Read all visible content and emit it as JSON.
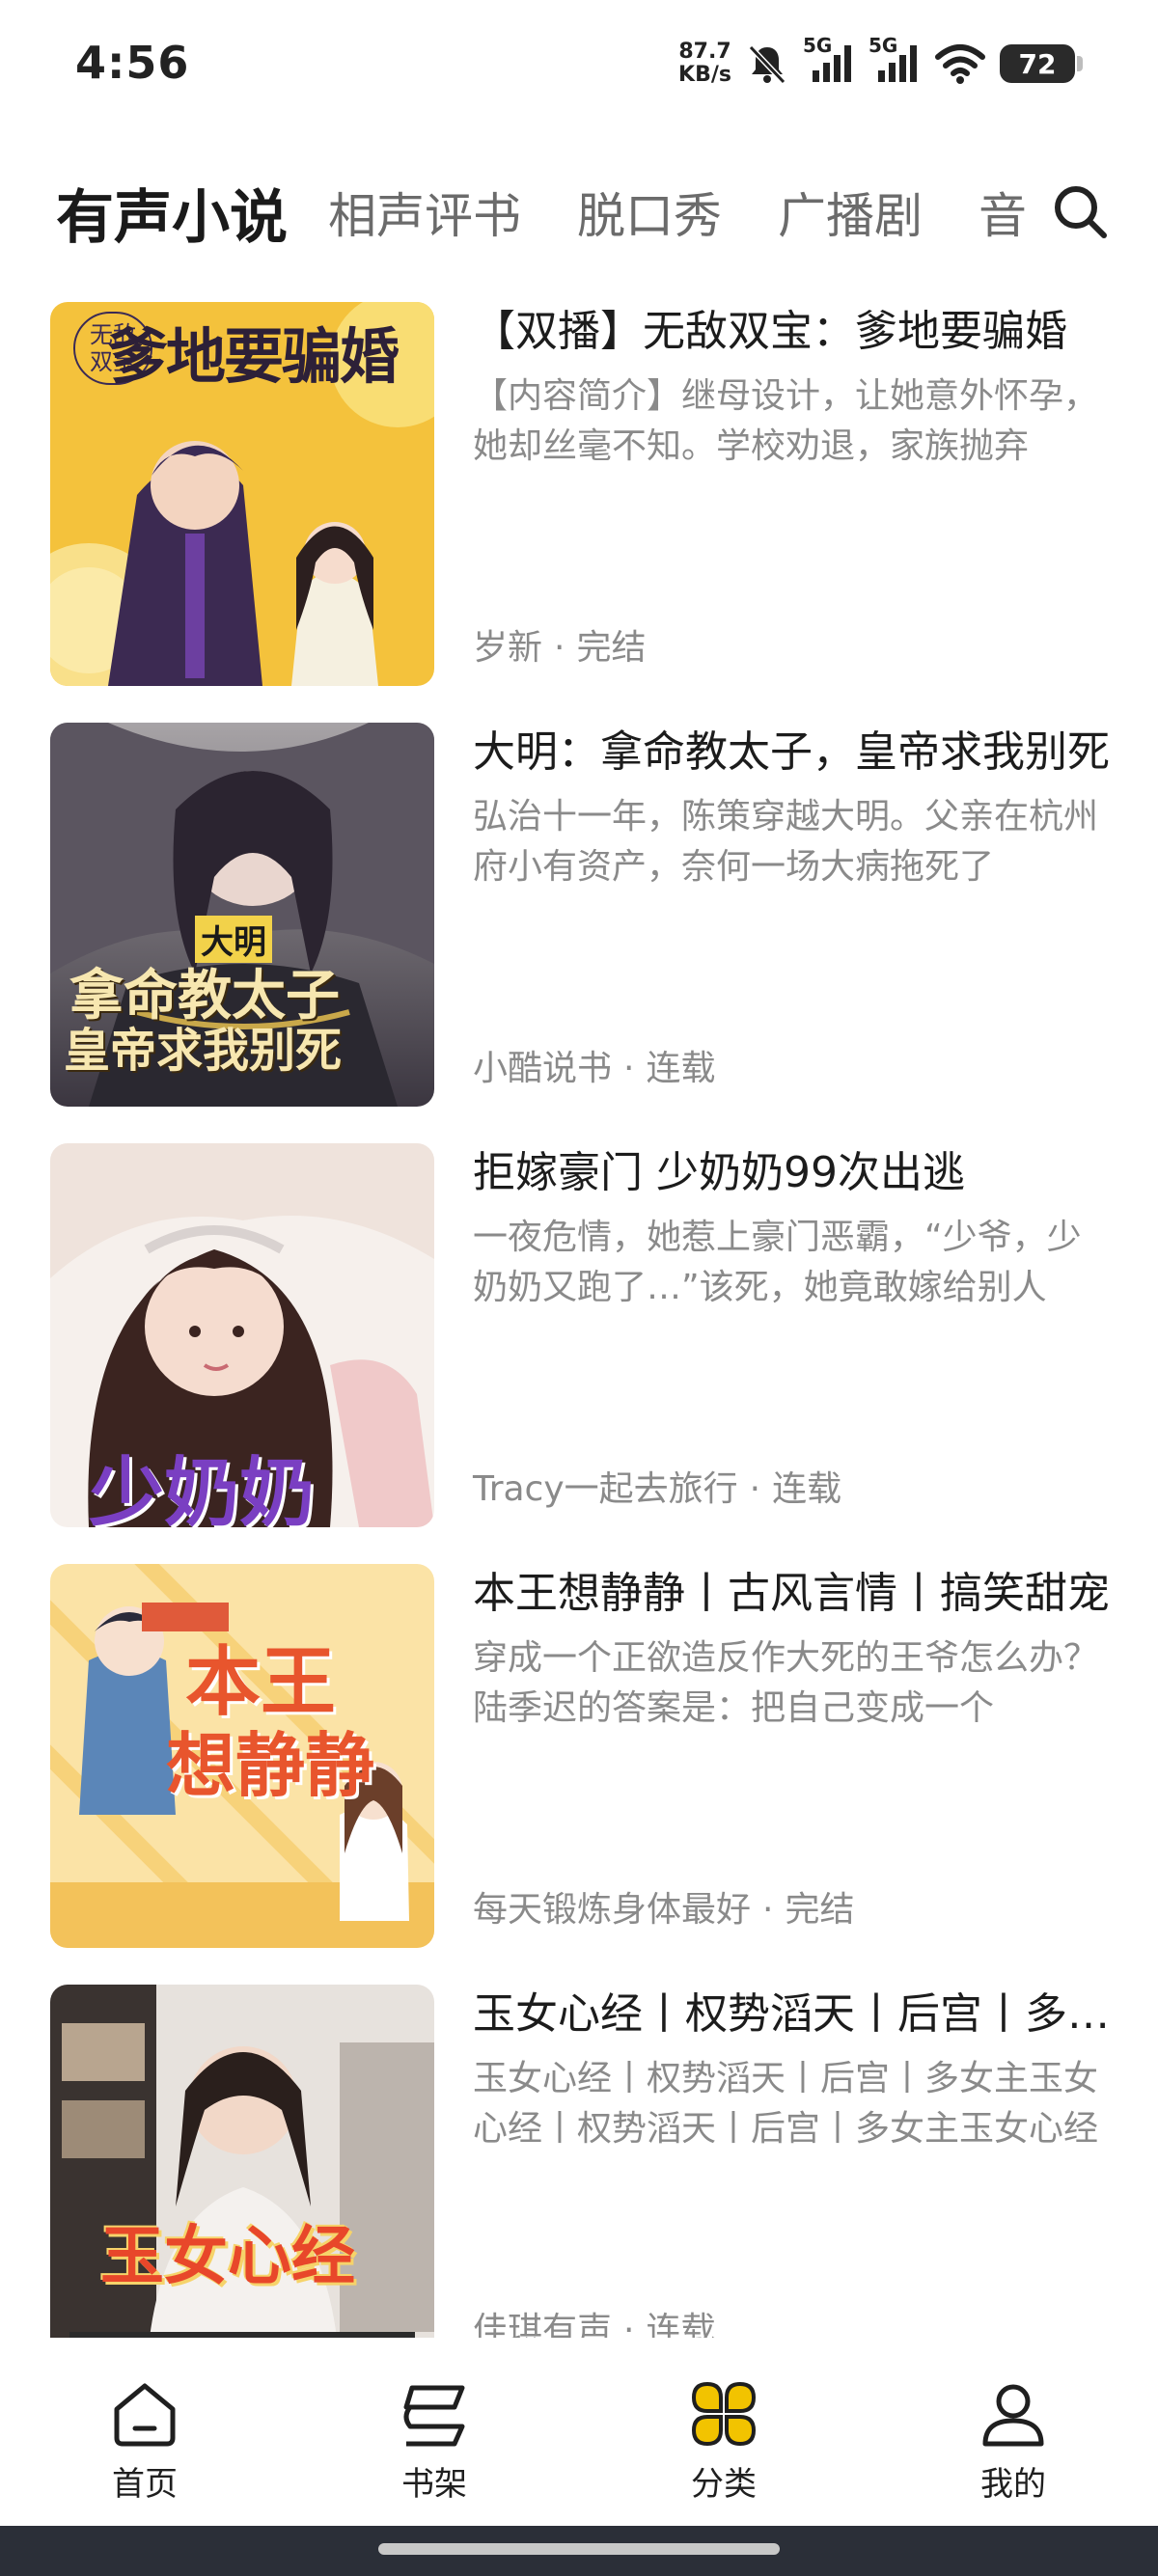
{
  "status_bar": {
    "time": "4:56",
    "net_speed_value": "87.7",
    "net_speed_unit": "KB/s",
    "signal_label_1": "5G",
    "signal_label_2": "5G",
    "battery": "72",
    "icons": [
      "mute-bell-icon",
      "signal-5g-icon",
      "signal-5g-icon",
      "wifi-icon",
      "battery-icon"
    ]
  },
  "tabs": [
    {
      "label": "有声小说",
      "active": true
    },
    {
      "label": "相声评书"
    },
    {
      "label": "脱口秀"
    },
    {
      "label": "广播剧"
    },
    {
      "label": "音"
    }
  ],
  "search_icon": "search-icon",
  "items": [
    {
      "title": "【双播】无敌双宝：爹地要骗婚",
      "description": "【内容简介】继母设计，让她意外怀孕，她却丝毫不知。学校劝退，家族抛弃",
      "author": "岁新",
      "status": "完结",
      "cover_text": "爹地要骗婚",
      "cover_badge": "无敌双宝"
    },
    {
      "title": "大明：拿命教太子，皇帝求我别死",
      "description": "弘治十一年，陈策穿越大明。父亲在杭州府小有资产，奈何一场大病拖死了",
      "author": "小酷说书",
      "status": "连载",
      "cover_text_top": "大明",
      "cover_text_1": "拿命教太子",
      "cover_text_2": "皇帝求我别死"
    },
    {
      "title": "拒嫁豪门 少奶奶99次出逃",
      "description": "一夜危情，她惹上豪门恶霸，“少爷，少奶奶又跑了…”该死，她竟敢嫁给别人",
      "author": "Tracy一起去旅行",
      "status": "连载",
      "cover_text": "少奶奶"
    },
    {
      "title": "本王想静静丨古风言情丨搞笑甜宠",
      "description": "穿成一个正欲造反作大死的王爷怎么办？陆季迟的答案是：把自己变成一个",
      "author": "每天锻炼身体最好",
      "status": "完结",
      "cover_text_1": "本王",
      "cover_text_2": "想静静"
    },
    {
      "title": "玉女心经丨权势滔天丨后宫丨多女主",
      "description": "玉女心经丨权势滔天丨后宫丨多女主玉女心经丨权势滔天丨后宫丨多女主玉女心经",
      "author": "佳琪有声",
      "status": "连载",
      "cover_text": "玉女心经"
    }
  ],
  "meta_separator": "·",
  "bottom_nav": [
    {
      "label": "首页",
      "icon": "home-icon"
    },
    {
      "label": "书架",
      "icon": "bookshelf-icon"
    },
    {
      "label": "分类",
      "icon": "category-icon",
      "active": true
    },
    {
      "label": "我的",
      "icon": "profile-icon"
    }
  ],
  "colors": {
    "active_tab": "#1a1a1a",
    "inactive_tab": "#6b6b6b",
    "secondary_text": "#8a8a8a",
    "accent_yellow": "#f2c300"
  }
}
